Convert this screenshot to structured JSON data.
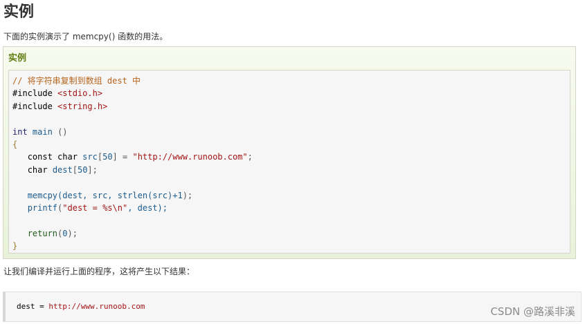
{
  "page": {
    "title": "实例",
    "intro": "下面的实例演示了 memcpy() 函数的用法。",
    "result_text": "让我们编译并运行上面的程序，这将产生以下结果：",
    "watermark": "CSDN @路溪非溪"
  },
  "example": {
    "title": "实例",
    "code": {
      "comment": "// 将字符串复制到数组 dest 中",
      "include1_kw": "#include",
      "include1_file": "<stdio.h>",
      "include2_kw": "#include",
      "include2_file": "<string.h>",
      "main_type": "int",
      "main_name": "main",
      "main_parens": "()",
      "open_brace": "{",
      "l1_kw": "const char",
      "l1_var": "src",
      "l1_idx_open": "[",
      "l1_size": "50",
      "l1_idx_close": "]",
      "l1_eq": " = ",
      "l1_str": "\"http://www.runoob.com\"",
      "l1_end": ";",
      "l2_kw": "char",
      "l2_var": "dest",
      "l2_idx_open": "[",
      "l2_size": "50",
      "l2_idx_close": "];",
      "l3_fn": "memcpy",
      "l3_args_a": "(dest, src, ",
      "l3_fn2": "strlen",
      "l3_args_b": "(src)+",
      "l3_num": "1",
      "l3_end": ");",
      "l4_fn": "printf",
      "l4_open": "(",
      "l4_str": "\"dest = %s\\n\"",
      "l4_args": ", dest);",
      "l5_kw": "return",
      "l5_open": "(",
      "l5_num": "0",
      "l5_end": ");",
      "close_brace": "}"
    }
  },
  "output": {
    "label": "dest = ",
    "url": "http://www.runoob.com"
  }
}
